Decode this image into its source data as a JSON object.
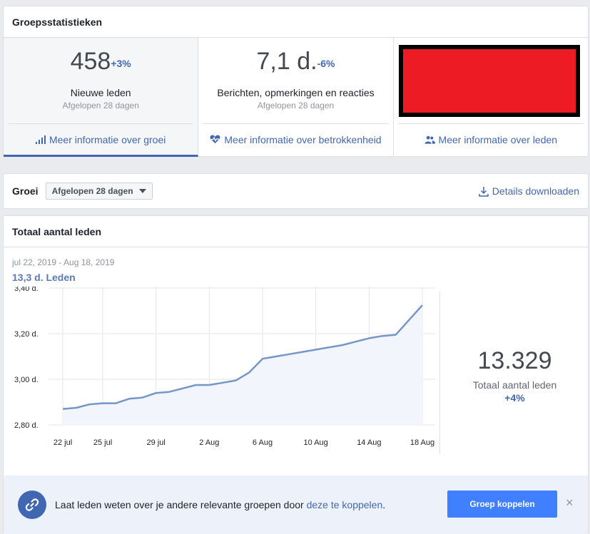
{
  "stats_card": {
    "title": "Groepsstatistieken",
    "stats": [
      {
        "value": "458",
        "delta": "+3%",
        "label": "Nieuwe leden",
        "sub": "Afgelopen 28 dagen",
        "link": "Meer informatie over groei",
        "icon": "bar-chart-icon"
      },
      {
        "value": "7,1 d.",
        "delta": "-6%",
        "label": "Berichten, opmerkingen en reacties",
        "sub": "Afgelopen 28 dagen",
        "link": "Meer informatie over betrokkenheid",
        "icon": "heart-pulse-icon"
      },
      {
        "link": "Meer informatie over leden",
        "icon": "people-icon"
      }
    ]
  },
  "groei_bar": {
    "label": "Groei",
    "dropdown_value": "Afgelopen 28 dagen",
    "download_label": "Details downloaden"
  },
  "members_card": {
    "title": "Totaal aantal leden",
    "date_range": "jul 22, 2019 - Aug 18, 2019",
    "metric_label": "13,3 d.  Leden",
    "total_value": "13.329",
    "total_label": "Totaal aantal leden",
    "total_delta": "+4%"
  },
  "chart_data": {
    "type": "area",
    "x": [
      "22 jul",
      "23 jul",
      "24 jul",
      "25 jul",
      "26 jul",
      "27 jul",
      "28 jul",
      "29 jul",
      "30 jul",
      "31 jul",
      "1 Aug",
      "2 Aug",
      "3 Aug",
      "4 Aug",
      "5 Aug",
      "6 Aug",
      "7 Aug",
      "8 Aug",
      "9 Aug",
      "10 Aug",
      "11 Aug",
      "12 Aug",
      "13 Aug",
      "14 Aug",
      "15 Aug",
      "16 Aug",
      "17 Aug",
      "18 Aug"
    ],
    "values": [
      2.87,
      2.875,
      2.89,
      2.895,
      2.895,
      2.915,
      2.92,
      2.94,
      2.945,
      2.96,
      2.975,
      2.975,
      2.985,
      2.995,
      3.03,
      3.09,
      3.1,
      3.11,
      3.12,
      3.13,
      3.14,
      3.15,
      3.165,
      3.18,
      3.19,
      3.195,
      3.26,
      3.325
    ],
    "x_tick_labels": [
      "22 jul",
      "25 jul",
      "29 jul",
      "2 Aug",
      "6 Aug",
      "10 Aug",
      "14 Aug",
      "18 Aug"
    ],
    "x_tick_indices": [
      0,
      3,
      7,
      11,
      15,
      19,
      23,
      27
    ],
    "y_ticks": [
      2.8,
      3.0,
      3.2,
      3.4
    ],
    "y_tick_labels": [
      "2,80 d.",
      "3,00 d.",
      "3,20 d.",
      "3,40 d."
    ],
    "ylim": [
      2.8,
      3.4
    ],
    "grid": true,
    "line_color": "#7596c8",
    "fill_color": "#f2f5fb"
  },
  "banner": {
    "text_before": "Laat leden weten over je andere relevante groepen door ",
    "link_text": "deze te koppelen",
    "text_after": ".",
    "button_label": "Groep koppelen",
    "close_label": "×"
  },
  "colors": {
    "accent": "#4267b2",
    "button": "#4080ff",
    "redacted": "#ed1c24"
  }
}
